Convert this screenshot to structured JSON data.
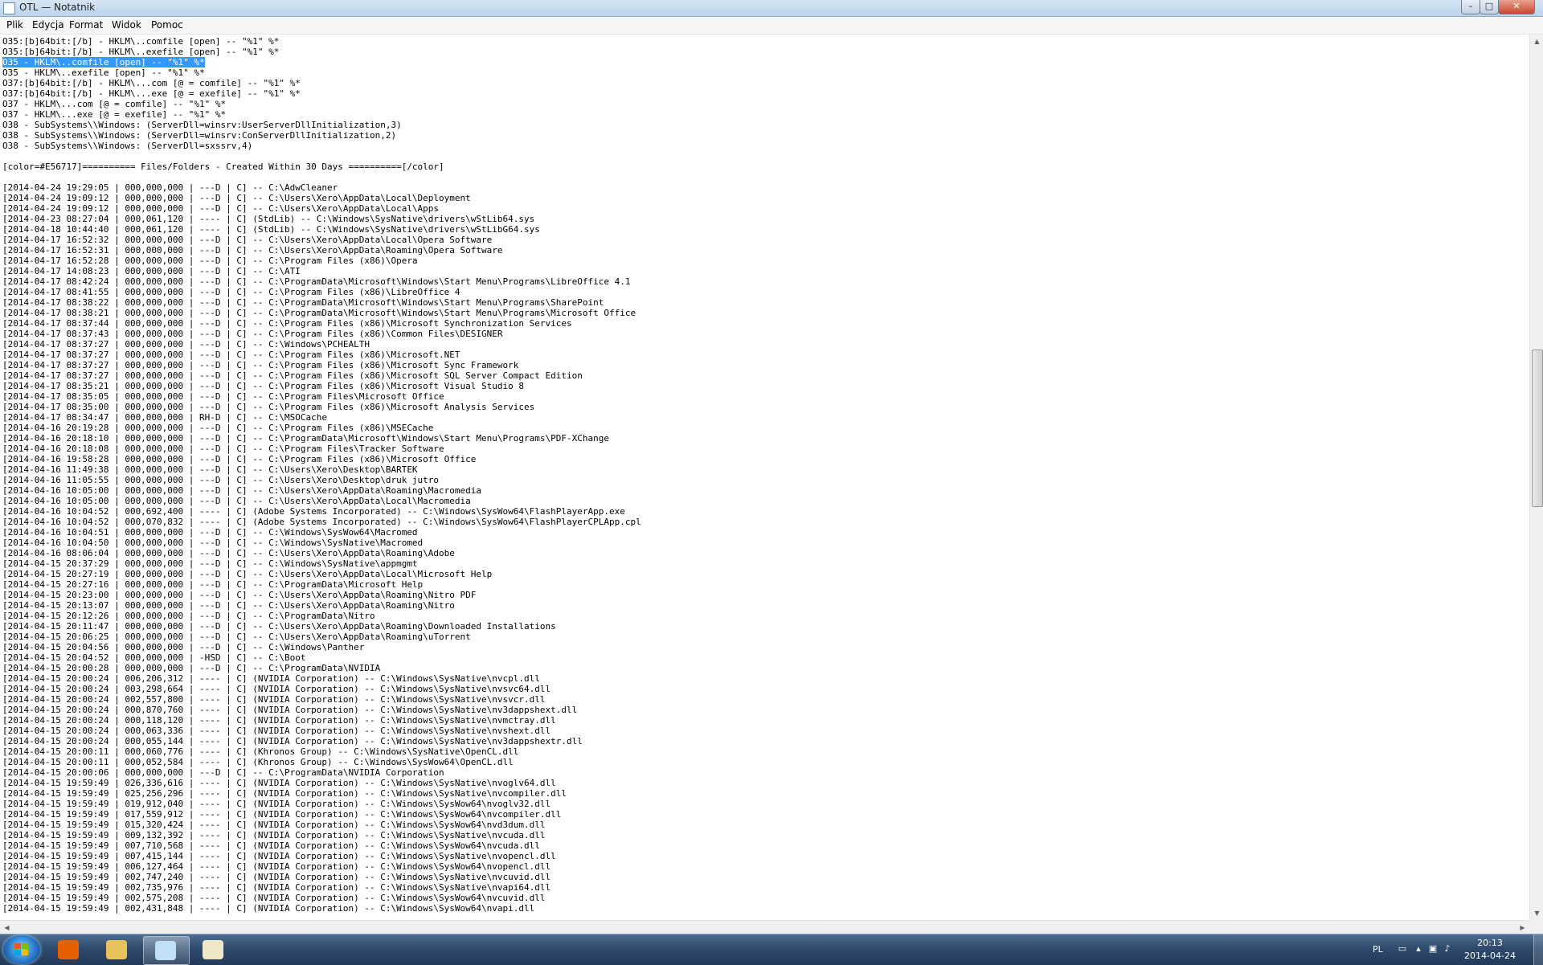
{
  "window": {
    "title": "OTL — Notatnik",
    "controls": {
      "minimize": "–",
      "maximize": "□",
      "close": "✕"
    }
  },
  "menu": {
    "items": [
      "Plik",
      "Edycja",
      "Format",
      "Widok",
      "Pomoc"
    ]
  },
  "editor": {
    "selected_line_index": 2,
    "lines": [
      "O35:[b]64bit:[/b] - HKLM\\..comfile [open] -- \"%1\" %*",
      "O35:[b]64bit:[/b] - HKLM\\..exefile [open] -- \"%1\" %*",
      "O35 - HKLM\\..comfile [open] -- \"%1\" %*",
      "O35 - HKLM\\..exefile [open] -- \"%1\" %*",
      "O37:[b]64bit:[/b] - HKLM\\...com [@ = comfile] -- \"%1\" %*",
      "O37:[b]64bit:[/b] - HKLM\\...exe [@ = exefile] -- \"%1\" %*",
      "O37 - HKLM\\...com [@ = comfile] -- \"%1\" %*",
      "O37 - HKLM\\...exe [@ = exefile] -- \"%1\" %*",
      "O38 - SubSystems\\\\Windows: (ServerDll=winsrv:UserServerDllInitialization,3)",
      "O38 - SubSystems\\\\Windows: (ServerDll=winsrv:ConServerDllInitialization,2)",
      "O38 - SubSystems\\\\Windows: (ServerDll=sxssrv,4)",
      "",
      "[color=#E56717]========== Files/Folders - Created Within 30 Days ==========[/color]",
      "",
      "[2014-04-24 19:29:05 | 000,000,000 | ---D | C] -- C:\\AdwCleaner",
      "[2014-04-24 19:09:12 | 000,000,000 | ---D | C] -- C:\\Users\\Xero\\AppData\\Local\\Deployment",
      "[2014-04-24 19:09:12 | 000,000,000 | ---D | C] -- C:\\Users\\Xero\\AppData\\Local\\Apps",
      "[2014-04-23 08:27:04 | 000,061,120 | ---- | C] (StdLib) -- C:\\Windows\\SysNative\\drivers\\wStLib64.sys",
      "[2014-04-18 10:44:40 | 000,061,120 | ---- | C] (StdLib) -- C:\\Windows\\SysNative\\drivers\\wStLibG64.sys",
      "[2014-04-17 16:52:32 | 000,000,000 | ---D | C] -- C:\\Users\\Xero\\AppData\\Local\\Opera Software",
      "[2014-04-17 16:52:31 | 000,000,000 | ---D | C] -- C:\\Users\\Xero\\AppData\\Roaming\\Opera Software",
      "[2014-04-17 16:52:28 | 000,000,000 | ---D | C] -- C:\\Program Files (x86)\\Opera",
      "[2014-04-17 14:08:23 | 000,000,000 | ---D | C] -- C:\\ATI",
      "[2014-04-17 08:42:24 | 000,000,000 | ---D | C] -- C:\\ProgramData\\Microsoft\\Windows\\Start Menu\\Programs\\LibreOffice 4.1",
      "[2014-04-17 08:41:55 | 000,000,000 | ---D | C] -- C:\\Program Files (x86)\\LibreOffice 4",
      "[2014-04-17 08:38:22 | 000,000,000 | ---D | C] -- C:\\ProgramData\\Microsoft\\Windows\\Start Menu\\Programs\\SharePoint",
      "[2014-04-17 08:38:21 | 000,000,000 | ---D | C] -- C:\\ProgramData\\Microsoft\\Windows\\Start Menu\\Programs\\Microsoft Office",
      "[2014-04-17 08:37:44 | 000,000,000 | ---D | C] -- C:\\Program Files (x86)\\Microsoft Synchronization Services",
      "[2014-04-17 08:37:43 | 000,000,000 | ---D | C] -- C:\\Program Files (x86)\\Common Files\\DESIGNER",
      "[2014-04-17 08:37:27 | 000,000,000 | ---D | C] -- C:\\Windows\\PCHEALTH",
      "[2014-04-17 08:37:27 | 000,000,000 | ---D | C] -- C:\\Program Files (x86)\\Microsoft.NET",
      "[2014-04-17 08:37:27 | 000,000,000 | ---D | C] -- C:\\Program Files (x86)\\Microsoft Sync Framework",
      "[2014-04-17 08:37:27 | 000,000,000 | ---D | C] -- C:\\Program Files (x86)\\Microsoft SQL Server Compact Edition",
      "[2014-04-17 08:35:21 | 000,000,000 | ---D | C] -- C:\\Program Files (x86)\\Microsoft Visual Studio 8",
      "[2014-04-17 08:35:05 | 000,000,000 | ---D | C] -- C:\\Program Files\\Microsoft Office",
      "[2014-04-17 08:35:00 | 000,000,000 | ---D | C] -- C:\\Program Files (x86)\\Microsoft Analysis Services",
      "[2014-04-17 08:34:47 | 000,000,000 | RH-D | C] -- C:\\MSOCache",
      "[2014-04-16 20:19:28 | 000,000,000 | ---D | C] -- C:\\Program Files (x86)\\MSECache",
      "[2014-04-16 20:18:10 | 000,000,000 | ---D | C] -- C:\\ProgramData\\Microsoft\\Windows\\Start Menu\\Programs\\PDF-XChange",
      "[2014-04-16 20:18:08 | 000,000,000 | ---D | C] -- C:\\Program Files\\Tracker Software",
      "[2014-04-16 19:58:28 | 000,000,000 | ---D | C] -- C:\\Program Files (x86)\\Microsoft Office",
      "[2014-04-16 11:49:38 | 000,000,000 | ---D | C] -- C:\\Users\\Xero\\Desktop\\BARTEK",
      "[2014-04-16 11:05:55 | 000,000,000 | ---D | C] -- C:\\Users\\Xero\\Desktop\\druk jutro",
      "[2014-04-16 10:05:00 | 000,000,000 | ---D | C] -- C:\\Users\\Xero\\AppData\\Roaming\\Macromedia",
      "[2014-04-16 10:05:00 | 000,000,000 | ---D | C] -- C:\\Users\\Xero\\AppData\\Local\\Macromedia",
      "[2014-04-16 10:04:52 | 000,692,400 | ---- | C] (Adobe Systems Incorporated) -- C:\\Windows\\SysWow64\\FlashPlayerApp.exe",
      "[2014-04-16 10:04:52 | 000,070,832 | ---- | C] (Adobe Systems Incorporated) -- C:\\Windows\\SysWow64\\FlashPlayerCPLApp.cpl",
      "[2014-04-16 10:04:51 | 000,000,000 | ---D | C] -- C:\\Windows\\SysWow64\\Macromed",
      "[2014-04-16 10:04:50 | 000,000,000 | ---D | C] -- C:\\Windows\\SysNative\\Macromed",
      "[2014-04-16 08:06:04 | 000,000,000 | ---D | C] -- C:\\Users\\Xero\\AppData\\Roaming\\Adobe",
      "[2014-04-15 20:37:29 | 000,000,000 | ---D | C] -- C:\\Windows\\SysNative\\appmgmt",
      "[2014-04-15 20:27:19 | 000,000,000 | ---D | C] -- C:\\Users\\Xero\\AppData\\Local\\Microsoft Help",
      "[2014-04-15 20:27:16 | 000,000,000 | ---D | C] -- C:\\ProgramData\\Microsoft Help",
      "[2014-04-15 20:23:00 | 000,000,000 | ---D | C] -- C:\\Users\\Xero\\AppData\\Roaming\\Nitro PDF",
      "[2014-04-15 20:13:07 | 000,000,000 | ---D | C] -- C:\\Users\\Xero\\AppData\\Roaming\\Nitro",
      "[2014-04-15 20:12:26 | 000,000,000 | ---D | C] -- C:\\ProgramData\\Nitro",
      "[2014-04-15 20:11:47 | 000,000,000 | ---D | C] -- C:\\Users\\Xero\\AppData\\Roaming\\Downloaded Installations",
      "[2014-04-15 20:06:25 | 000,000,000 | ---D | C] -- C:\\Users\\Xero\\AppData\\Roaming\\uTorrent",
      "[2014-04-15 20:04:56 | 000,000,000 | ---D | C] -- C:\\Windows\\Panther",
      "[2014-04-15 20:04:52 | 000,000,000 | -HSD | C] -- C:\\Boot",
      "[2014-04-15 20:00:28 | 000,000,000 | ---D | C] -- C:\\ProgramData\\NVIDIA",
      "[2014-04-15 20:00:24 | 006,206,312 | ---- | C] (NVIDIA Corporation) -- C:\\Windows\\SysNative\\nvcpl.dll",
      "[2014-04-15 20:00:24 | 003,298,664 | ---- | C] (NVIDIA Corporation) -- C:\\Windows\\SysNative\\nvsvc64.dll",
      "[2014-04-15 20:00:24 | 002,557,800 | ---- | C] (NVIDIA Corporation) -- C:\\Windows\\SysNative\\nvsvcr.dll",
      "[2014-04-15 20:00:24 | 000,870,760 | ---- | C] (NVIDIA Corporation) -- C:\\Windows\\SysNative\\nv3dappshext.dll",
      "[2014-04-15 20:00:24 | 000,118,120 | ---- | C] (NVIDIA Corporation) -- C:\\Windows\\SysNative\\nvmctray.dll",
      "[2014-04-15 20:00:24 | 000,063,336 | ---- | C] (NVIDIA Corporation) -- C:\\Windows\\SysNative\\nvshext.dll",
      "[2014-04-15 20:00:24 | 000,055,144 | ---- | C] (NVIDIA Corporation) -- C:\\Windows\\SysNative\\nv3dappshextr.dll",
      "[2014-04-15 20:00:11 | 000,060,776 | ---- | C] (Khronos Group) -- C:\\Windows\\SysNative\\OpenCL.dll",
      "[2014-04-15 20:00:11 | 000,052,584 | ---- | C] (Khronos Group) -- C:\\Windows\\SysWow64\\OpenCL.dll",
      "[2014-04-15 20:00:06 | 000,000,000 | ---D | C] -- C:\\ProgramData\\NVIDIA Corporation",
      "[2014-04-15 19:59:49 | 026,336,616 | ---- | C] (NVIDIA Corporation) -- C:\\Windows\\SysNative\\nvoglv64.dll",
      "[2014-04-15 19:59:49 | 025,256,296 | ---- | C] (NVIDIA Corporation) -- C:\\Windows\\SysNative\\nvcompiler.dll",
      "[2014-04-15 19:59:49 | 019,912,040 | ---- | C] (NVIDIA Corporation) -- C:\\Windows\\SysWow64\\nvoglv32.dll",
      "[2014-04-15 19:59:49 | 017,559,912 | ---- | C] (NVIDIA Corporation) -- C:\\Windows\\SysWow64\\nvcompiler.dll",
      "[2014-04-15 19:59:49 | 015,320,424 | ---- | C] (NVIDIA Corporation) -- C:\\Windows\\SysWow64\\nvd3dum.dll",
      "[2014-04-15 19:59:49 | 009,132,392 | ---- | C] (NVIDIA Corporation) -- C:\\Windows\\SysNative\\nvcuda.dll",
      "[2014-04-15 19:59:49 | 007,710,568 | ---- | C] (NVIDIA Corporation) -- C:\\Windows\\SysWow64\\nvcuda.dll",
      "[2014-04-15 19:59:49 | 007,415,144 | ---- | C] (NVIDIA Corporation) -- C:\\Windows\\SysNative\\nvopencl.dll",
      "[2014-04-15 19:59:49 | 006,127,464 | ---- | C] (NVIDIA Corporation) -- C:\\Windows\\SysWow64\\nvopencl.dll",
      "[2014-04-15 19:59:49 | 002,747,240 | ---- | C] (NVIDIA Corporation) -- C:\\Windows\\SysNative\\nvcuvid.dll",
      "[2014-04-15 19:59:49 | 002,735,976 | ---- | C] (NVIDIA Corporation) -- C:\\Windows\\SysNative\\nvapi64.dll",
      "[2014-04-15 19:59:49 | 002,575,208 | ---- | C] (NVIDIA Corporation) -- C:\\Windows\\SysWow64\\nvcuvid.dll",
      "[2014-04-15 19:59:49 | 002,431,848 | ---- | C] (NVIDIA Corporation) -- C:\\Windows\\SysWow64\\nvapi.dll"
    ]
  },
  "taskbar": {
    "apps": [
      {
        "icon": "firefox-icon",
        "color": "#e66000",
        "active": false
      },
      {
        "icon": "folder-icon",
        "color": "#e8c25a",
        "active": false
      },
      {
        "icon": "notepad-icon",
        "color": "#bfe0f5",
        "active": true
      },
      {
        "icon": "paint-icon",
        "color": "#f0e6c8",
        "active": false
      }
    ],
    "tray": {
      "language": "PL",
      "time": "20:13",
      "date": "2014-04-24"
    }
  }
}
